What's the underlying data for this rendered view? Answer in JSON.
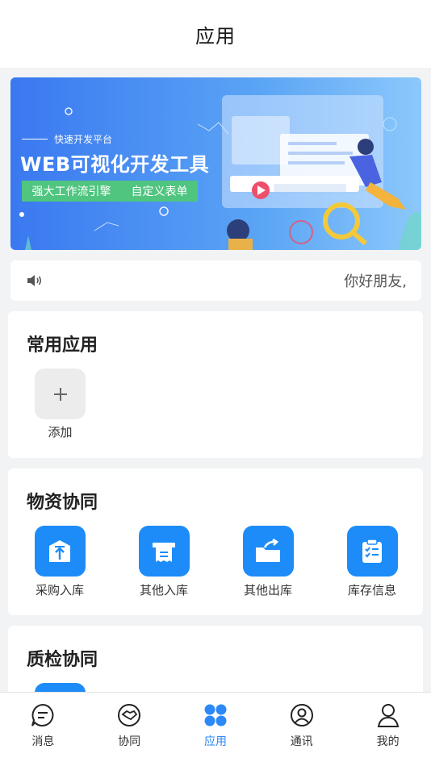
{
  "header": {
    "title": "应用"
  },
  "banner": {
    "subtitle": "快速开发平台",
    "title": "WEB可视化开发工具",
    "tags": [
      "强大工作流引擎",
      "自定义表单"
    ]
  },
  "notice": {
    "icon": "speaker-icon",
    "text": "你好朋友,"
  },
  "common_apps": {
    "title": "常用应用",
    "add_label": "添加"
  },
  "material": {
    "title": "物资协同",
    "items": [
      {
        "label": "采购入库",
        "icon": "box-upload-icon"
      },
      {
        "label": "其他入库",
        "icon": "receipt-printer-icon"
      },
      {
        "label": "其他出库",
        "icon": "folder-export-icon"
      },
      {
        "label": "库存信息",
        "icon": "checklist-icon"
      }
    ]
  },
  "quality": {
    "title": "质检协同"
  },
  "tabbar": {
    "active_color": "#2c88f5",
    "items": [
      {
        "label": "消息",
        "icon": "message-icon"
      },
      {
        "label": "协同",
        "icon": "handshake-icon"
      },
      {
        "label": "应用",
        "icon": "apps-grid-icon",
        "active": true
      },
      {
        "label": "通讯",
        "icon": "contact-icon"
      },
      {
        "label": "我的",
        "icon": "user-icon"
      }
    ]
  }
}
